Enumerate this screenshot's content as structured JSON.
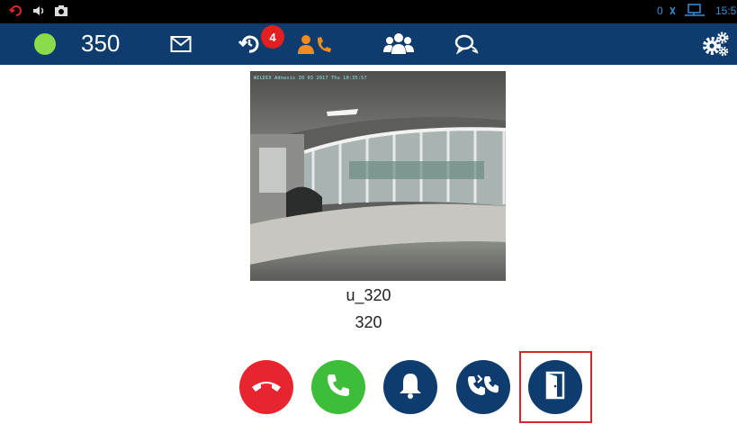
{
  "status_bar": {
    "clock": "15:5",
    "indicator": "0",
    "icons": [
      "missed-call-icon",
      "volume-icon",
      "camera-icon",
      "signal-icon",
      "network-icon"
    ]
  },
  "toolbar": {
    "presence_color": "#8bdc4a",
    "extension": "350",
    "missed_count": "4",
    "tabs": [
      "mail-icon",
      "call-history-icon",
      "contacts-calls-icon",
      "groups-icon",
      "chat-icon"
    ],
    "active_tab": "contacts-calls-icon",
    "settings": "settings-gears-icon"
  },
  "video": {
    "overlay_text": "WILDIX Adnexis  30 03 2017 Thu 10:35:57"
  },
  "caller": {
    "name": "u_320",
    "number": "320"
  },
  "actions": [
    {
      "id": "hangup",
      "icon": "hangup-icon",
      "color": "#e8242e"
    },
    {
      "id": "answer",
      "icon": "phone-icon",
      "color": "#3ebd3a"
    },
    {
      "id": "ring",
      "icon": "bell-icon",
      "color": "#0e3c6e"
    },
    {
      "id": "transfer",
      "icon": "transfer-icon",
      "color": "#0e3c6e"
    },
    {
      "id": "open-door",
      "icon": "door-icon",
      "color": "#0e3c6e"
    }
  ],
  "colors": {
    "toolbar_bg": "#0e3c6e",
    "active_tab": "#f08c1e",
    "highlight": "#d8272b"
  }
}
